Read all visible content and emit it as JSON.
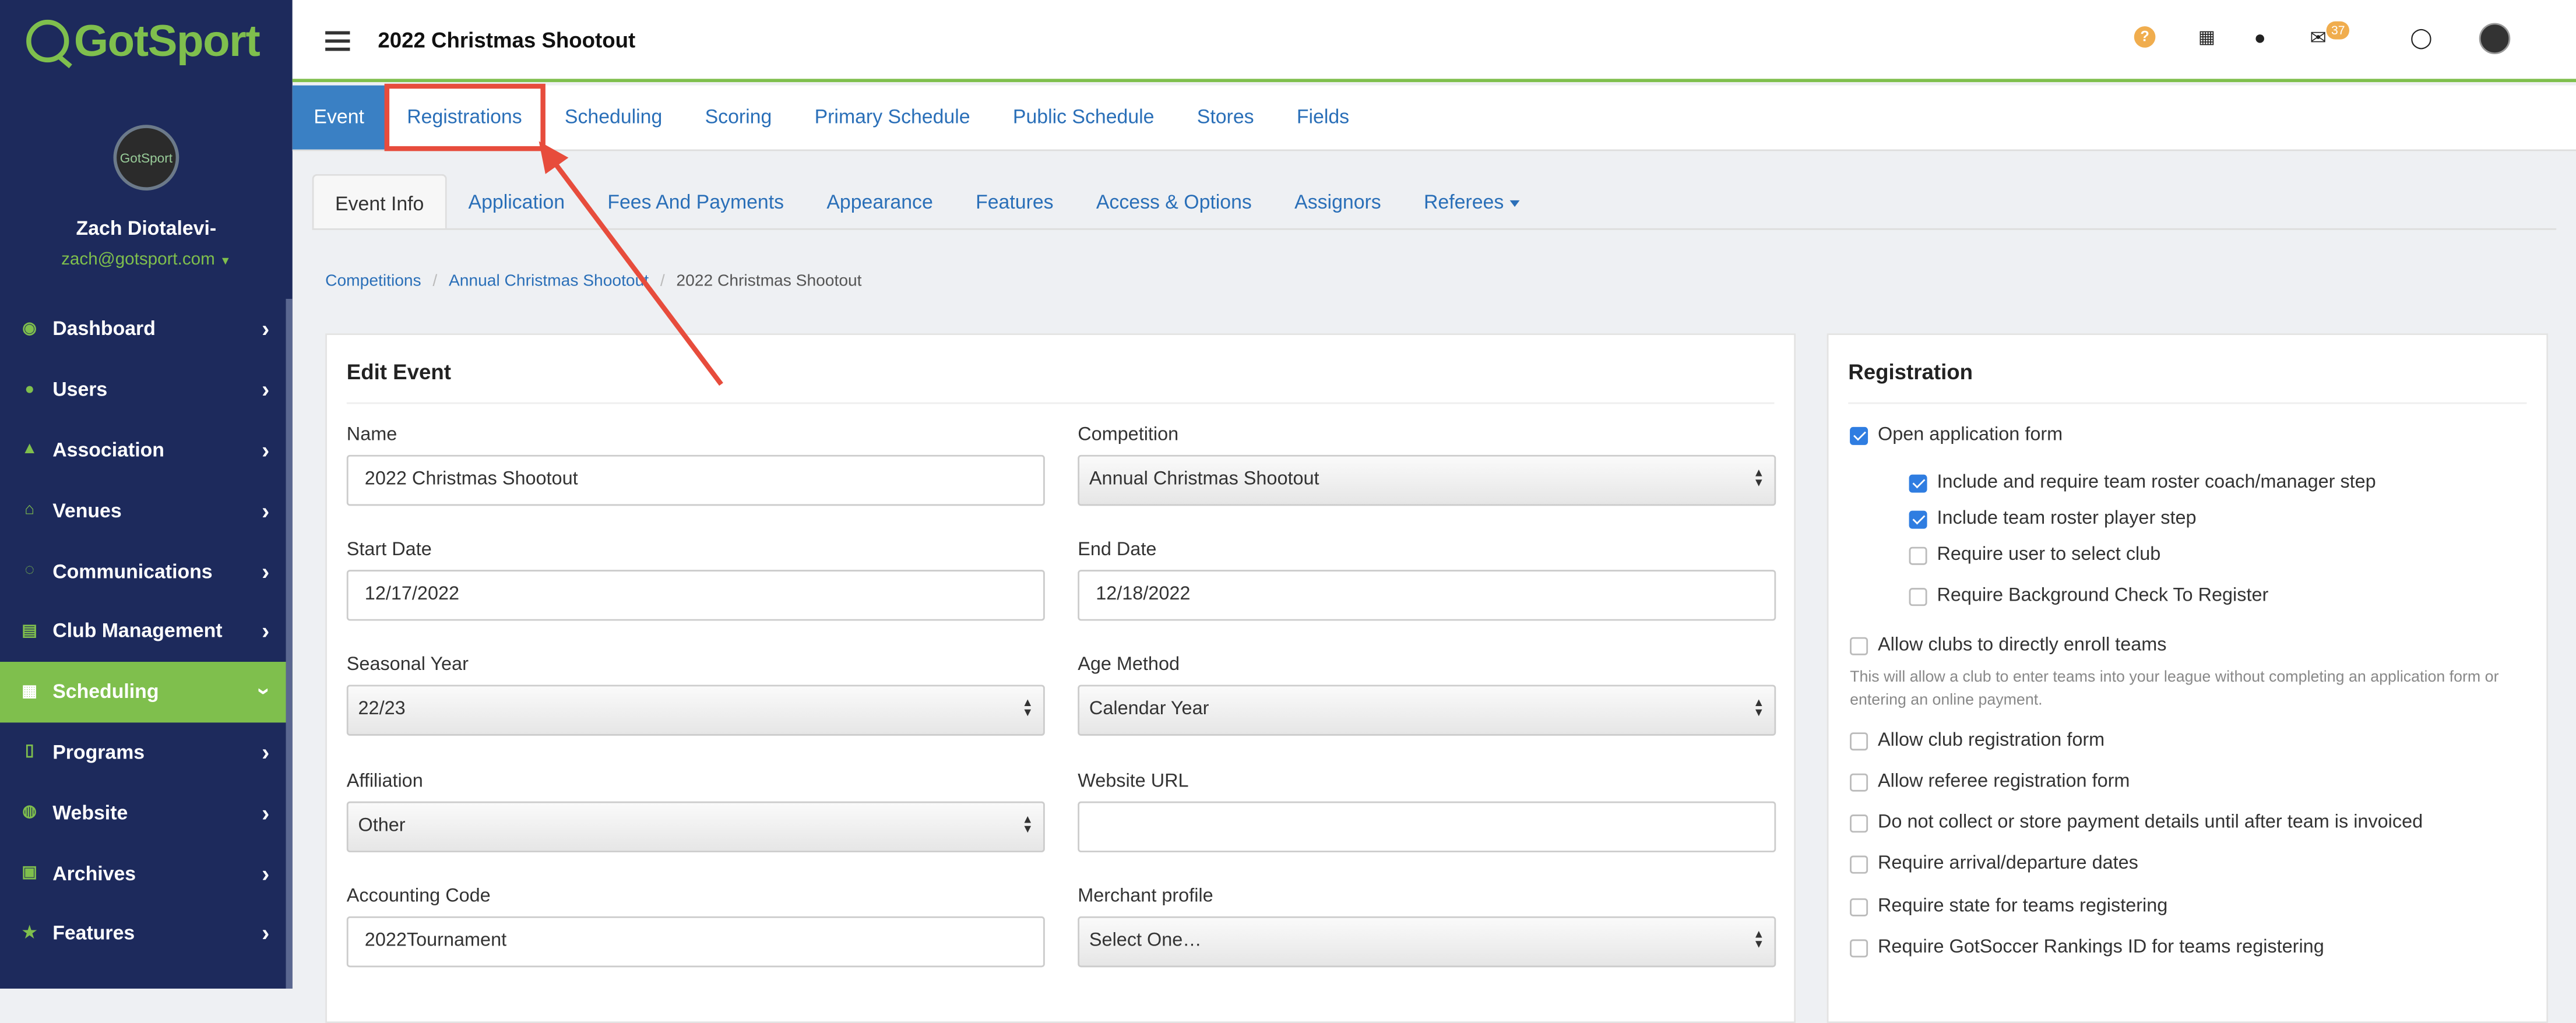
{
  "sidebar": {
    "brand": "GotSport",
    "avatar_text": "GotSport",
    "user_name": "Zach Diotalevi-",
    "user_email": "zach@gotsport.com",
    "items": [
      {
        "label": "Dashboard",
        "icon": "dashboard-icon"
      },
      {
        "label": "Users",
        "icon": "users-icon"
      },
      {
        "label": "Association",
        "icon": "sitemap-icon"
      },
      {
        "label": "Venues",
        "icon": "home-icon"
      },
      {
        "label": "Communications",
        "icon": "comments-icon"
      },
      {
        "label": "Club Management",
        "icon": "list-icon"
      },
      {
        "label": "Scheduling",
        "icon": "table-icon",
        "active": true
      },
      {
        "label": "Programs",
        "icon": "document-icon"
      },
      {
        "label": "Website",
        "icon": "globe-icon"
      },
      {
        "label": "Archives",
        "icon": "archive-icon"
      },
      {
        "label": "Features",
        "icon": "star-icon"
      }
    ]
  },
  "topbar": {
    "title": "2022 Christmas Shootout",
    "help_glyph": "?",
    "mail_badge": "37"
  },
  "primary_tabs": [
    "Event",
    "Registrations",
    "Scheduling",
    "Scoring",
    "Primary Schedule",
    "Public Schedule",
    "Stores",
    "Fields"
  ],
  "secondary_tabs": [
    "Event Info",
    "Application",
    "Fees And Payments",
    "Appearance",
    "Features",
    "Access & Options",
    "Assignors",
    "Referees"
  ],
  "breadcrumb": [
    "Competitions",
    "Annual Christmas Shootout",
    "2022 Christmas Shootout"
  ],
  "edit_event": {
    "title": "Edit Event",
    "name_label": "Name",
    "name_value": "2022 Christmas Shootout",
    "competition_label": "Competition",
    "competition_value": "Annual Christmas Shootout",
    "start_label": "Start Date",
    "start_value": "12/17/2022",
    "end_label": "End Date",
    "end_value": "12/18/2022",
    "season_label": "Seasonal Year",
    "season_value": "22/23",
    "age_label": "Age Method",
    "age_value": "Calendar Year",
    "affiliation_label": "Affiliation",
    "affiliation_value": "Other",
    "website_label": "Website URL",
    "website_value": "",
    "accounting_label": "Accounting Code",
    "accounting_value": "2022Tournament",
    "merchant_label": "Merchant profile",
    "merchant_value": "Select One…"
  },
  "registration": {
    "title": "Registration",
    "open_form": "Open application form",
    "roster_coach": "Include and require team roster coach/manager step",
    "roster_player": "Include team roster player step",
    "require_club": "Require user to select club",
    "background_check": "Require Background Check To Register",
    "clubs_enroll": "Allow clubs to directly enroll teams",
    "clubs_enroll_help": "This will allow a club to enter teams into your league without completing an application form or entering an online payment.",
    "club_form": "Allow club registration form",
    "referee_form": "Allow referee registration form",
    "no_payment": "Do not collect or store payment details until after team is invoiced",
    "arrival_dates": "Require arrival/departure dates",
    "state_required": "Require state for teams registering",
    "rankings_id": "Require GotSoccer Rankings ID for teams registering"
  },
  "colors": {
    "sidebar": "#1d2a5c",
    "accent": "#7fbf4d",
    "link": "#2a6fb8",
    "highlight": "#e74c3c"
  }
}
